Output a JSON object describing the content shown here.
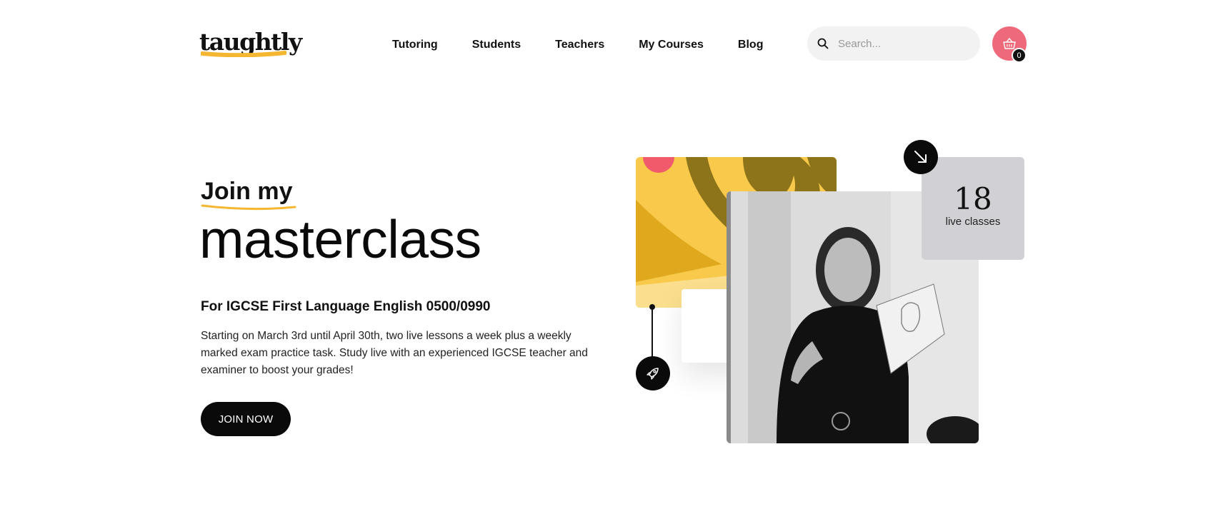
{
  "header": {
    "logo_text": "taughtly",
    "nav": [
      {
        "label": "Tutoring"
      },
      {
        "label": "Students"
      },
      {
        "label": "Teachers"
      },
      {
        "label": "My Courses"
      },
      {
        "label": "Blog"
      }
    ],
    "search": {
      "placeholder": "Search...",
      "value": "",
      "icon": "search-icon"
    },
    "cart": {
      "icon": "basket-icon",
      "count": "0"
    }
  },
  "hero": {
    "eyebrow": "Join my",
    "title": "masterclass",
    "subtitle": "For IGCSE First Language English 0500/0990",
    "description": "Starting on March 3rd until April 30th, two live lessons a week plus a weekly marked exam practice task. Study live with an experienced IGCSE teacher and examiner to boost your grades!",
    "cta_label": "JOIN NOW"
  },
  "stats": {
    "number": "18",
    "label": "live classes"
  },
  "icons": {
    "arrow": "arrow-down-right-icon",
    "rocket": "rocket-icon"
  },
  "colors": {
    "accent_yellow": "#f8c94a",
    "cart_pink": "#ee6a7b",
    "stat_card_gray": "#d1d1d5",
    "underline_yellow": "#f5b731",
    "button_black": "#0a0a0a"
  }
}
